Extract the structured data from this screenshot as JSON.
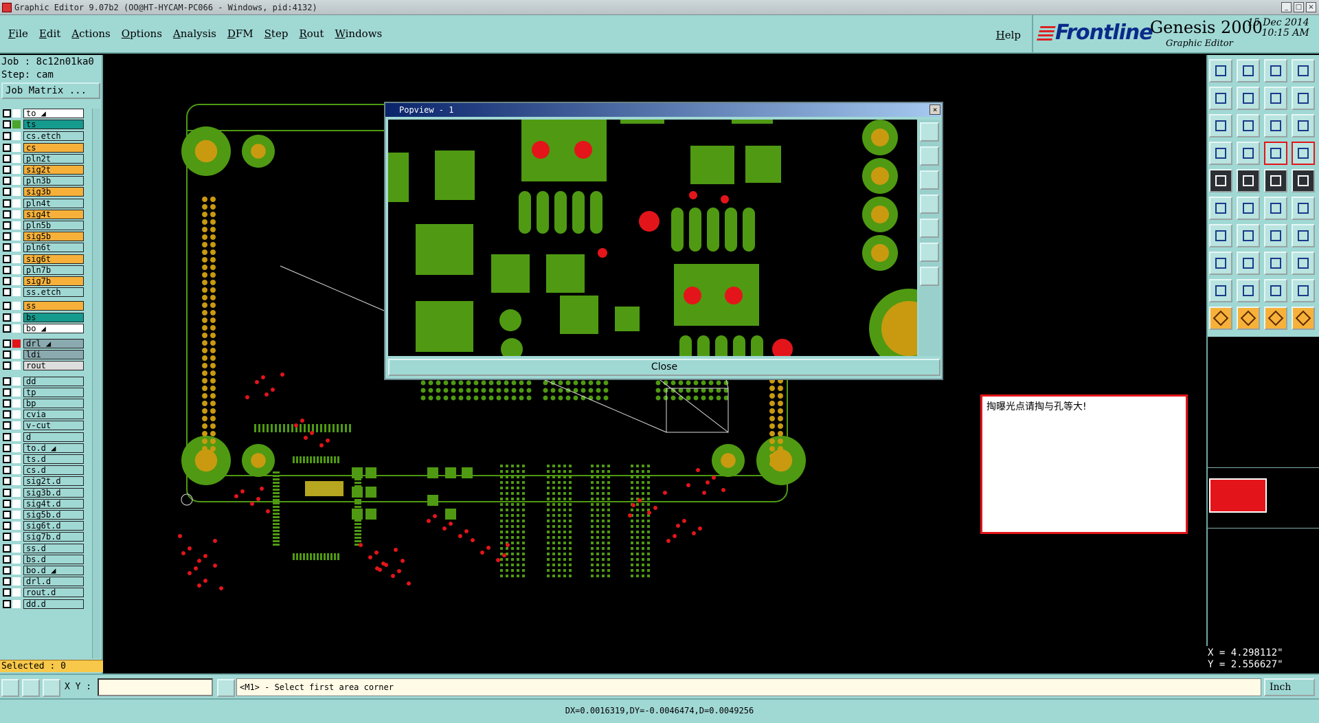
{
  "window": {
    "title": "Graphic Editor 9.07b2 (OO@HT-HYCAM-PC066 - Windows, pid:4132)"
  },
  "menu": {
    "items": [
      "File",
      "Edit",
      "Actions",
      "Options",
      "Analysis",
      "DFM",
      "Step",
      "Rout",
      "Windows"
    ],
    "help": "Help"
  },
  "brand": {
    "logo": "Frontline",
    "product": "Genesis 2000",
    "subtitle": "Graphic Editor",
    "date": "15 Dec 2014",
    "time": "10:15 AM"
  },
  "job": {
    "job_line": "Job : 8c12n01ka0",
    "step_line": "Step: cam",
    "matrix_button": "Job Matrix ..."
  },
  "layers": [
    {
      "name": "to",
      "color": "#ffffff",
      "state": "#ffffff",
      "mark": true
    },
    {
      "name": "ts",
      "color": "#159a8e",
      "state": "#4aa52a",
      "mark": false
    },
    {
      "name": "cs.etch",
      "color": "#a0d8d4",
      "state": "#ffffff",
      "mark": false
    },
    {
      "name": "cs",
      "color": "#f7b13a",
      "state": "#ffffff",
      "mark": false
    },
    {
      "name": "pln2t",
      "color": "#a0d8d4",
      "state": "#ffffff",
      "mark": false
    },
    {
      "name": "sig2t",
      "color": "#f7b13a",
      "state": "#ffffff",
      "mark": false
    },
    {
      "name": "pln3b",
      "color": "#a0d8d4",
      "state": "#ffffff",
      "mark": false
    },
    {
      "name": "sig3b",
      "color": "#f7b13a",
      "state": "#ffffff",
      "mark": false
    },
    {
      "name": "pln4t",
      "color": "#a0d8d4",
      "state": "#ffffff",
      "mark": false
    },
    {
      "name": "sig4t",
      "color": "#f7b13a",
      "state": "#ffffff",
      "mark": false
    },
    {
      "name": "pln5b",
      "color": "#a0d8d4",
      "state": "#ffffff",
      "mark": false
    },
    {
      "name": "sig5b",
      "color": "#f7b13a",
      "state": "#ffffff",
      "mark": false
    },
    {
      "name": "pln6t",
      "color": "#a0d8d4",
      "state": "#ffffff",
      "mark": false
    },
    {
      "name": "sig6t",
      "color": "#f7b13a",
      "state": "#ffffff",
      "mark": false
    },
    {
      "name": "pln7b",
      "color": "#a0d8d4",
      "state": "#ffffff",
      "mark": false
    },
    {
      "name": "sig7b",
      "color": "#f7b13a",
      "state": "#ffffff",
      "mark": false
    },
    {
      "name": "ss.etch",
      "color": "#a0d8d4",
      "state": "#ffffff",
      "mark": false
    },
    {
      "name": "ss",
      "color": "#f7b13a",
      "state": "#ffffff",
      "mark": false
    },
    {
      "name": "bs",
      "color": "#159a8e",
      "state": "#ffffff",
      "mark": false
    },
    {
      "name": "bo",
      "color": "#ffffff",
      "state": "#ffffff",
      "mark": true
    },
    {
      "name": "drl",
      "color": "#8aaab0",
      "state": "#e3151a",
      "mark": true
    },
    {
      "name": "ldi",
      "color": "#8aaab0",
      "state": "#ffffff",
      "mark": false
    },
    {
      "name": "rout",
      "color": "#dddddd",
      "state": "#ffffff",
      "mark": false
    },
    {
      "name": "dd",
      "color": "#a0d8d4",
      "state": "#ffffff",
      "mark": false
    },
    {
      "name": "tp",
      "color": "#a0d8d4",
      "state": "#ffffff",
      "mark": false
    },
    {
      "name": "bp",
      "color": "#a0d8d4",
      "state": "#ffffff",
      "mark": false
    },
    {
      "name": "cvia",
      "color": "#a0d8d4",
      "state": "#ffffff",
      "mark": false
    },
    {
      "name": "v-cut",
      "color": "#a0d8d4",
      "state": "#ffffff",
      "mark": false
    },
    {
      "name": "d",
      "color": "#a0d8d4",
      "state": "#ffffff",
      "mark": false
    },
    {
      "name": "to.d",
      "color": "#a0d8d4",
      "state": "#ffffff",
      "mark": true
    },
    {
      "name": "ts.d",
      "color": "#a0d8d4",
      "state": "#ffffff",
      "mark": false
    },
    {
      "name": "cs.d",
      "color": "#a0d8d4",
      "state": "#ffffff",
      "mark": false
    },
    {
      "name": "sig2t.d",
      "color": "#a0d8d4",
      "state": "#ffffff",
      "mark": false
    },
    {
      "name": "sig3b.d",
      "color": "#a0d8d4",
      "state": "#ffffff",
      "mark": false
    },
    {
      "name": "sig4t.d",
      "color": "#a0d8d4",
      "state": "#ffffff",
      "mark": false
    },
    {
      "name": "sig5b.d",
      "color": "#a0d8d4",
      "state": "#ffffff",
      "mark": false
    },
    {
      "name": "sig6t.d",
      "color": "#a0d8d4",
      "state": "#ffffff",
      "mark": false
    },
    {
      "name": "sig7b.d",
      "color": "#a0d8d4",
      "state": "#ffffff",
      "mark": false
    },
    {
      "name": "ss.d",
      "color": "#a0d8d4",
      "state": "#ffffff",
      "mark": false
    },
    {
      "name": "bs.d",
      "color": "#a0d8d4",
      "state": "#ffffff",
      "mark": false
    },
    {
      "name": "bo.d",
      "color": "#a0d8d4",
      "state": "#ffffff",
      "mark": true
    },
    {
      "name": "drl.d",
      "color": "#a0d8d4",
      "state": "#ffffff",
      "mark": false
    },
    {
      "name": "rout.d",
      "color": "#a0d8d4",
      "state": "#ffffff",
      "mark": false
    },
    {
      "name": "dd.d",
      "color": "#a0d8d4",
      "state": "#ffffff",
      "mark": false
    }
  ],
  "selected": "Selected : 0",
  "popview": {
    "title": "Popview - 1",
    "close_label": "Close"
  },
  "message": "掏曝光点请掏与孔等大!",
  "coords": {
    "x": "X = 4.298112\"",
    "y": "Y = 2.556627\""
  },
  "bottom": {
    "xy_label": "X Y :",
    "prompt": "<M1> - Select first area corner",
    "unit": "Inch"
  },
  "status": "DX=0.0016319,DY=-0.0046474,D=0.0049256",
  "colors": {
    "panel": "#a0d8d4",
    "pad": "#4f9a12",
    "hole": "#c99a10",
    "drill": "#e3151a",
    "layer_orange": "#f7b13a",
    "layer_teal": "#159a8e"
  }
}
